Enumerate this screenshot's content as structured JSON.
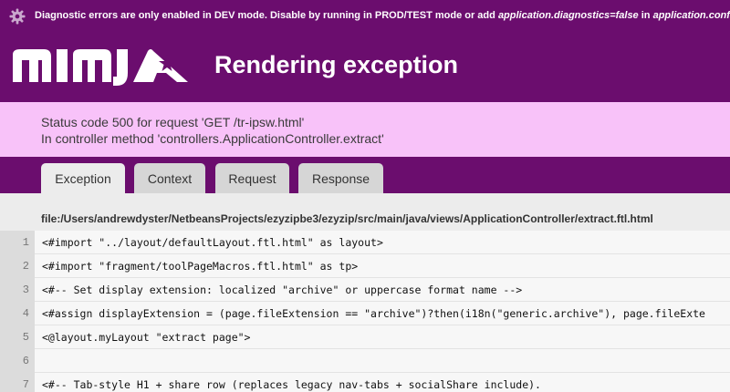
{
  "notice": {
    "prefix": "Diagnostic errors are only enabled in DEV mode. Disable by running in PROD/TEST mode or add ",
    "setting": "application.diagnostics=false",
    "middle": " in ",
    "file": "application.conf"
  },
  "logo": {
    "text": "NINJA"
  },
  "page": {
    "title": "Rendering exception"
  },
  "status": {
    "line1": "Status code 500 for request 'GET /tr-ipsw.html'",
    "line2": "In controller method 'controllers.ApplicationController.extract'"
  },
  "tabs": {
    "exception": "Exception",
    "context": "Context",
    "request": "Request",
    "response": "Response"
  },
  "source": {
    "path": "file:/Users/andrewdyster/NetbeansProjects/ezyzipbe3/ezyzip/src/main/java/views/ApplicationController/extract.ftl.html",
    "lines": [
      {
        "num": "1",
        "text": "<#import \"../layout/defaultLayout.ftl.html\" as layout>"
      },
      {
        "num": "2",
        "text": "<#import \"fragment/toolPageMacros.ftl.html\" as tp>"
      },
      {
        "num": "3",
        "text": "<#-- Set display extension: localized \"archive\" or uppercase format name -->"
      },
      {
        "num": "4",
        "text": "<#assign displayExtension = (page.fileExtension == \"archive\")?then(i18n(\"generic.archive\"), page.fileExte"
      },
      {
        "num": "5",
        "text": "<@layout.myLayout \"extract page\">"
      },
      {
        "num": "6",
        "text": ""
      },
      {
        "num": "7",
        "text": "<#-- Tab-style H1 + share row (replaces legacy nav-tabs + socialShare include)."
      }
    ]
  }
}
